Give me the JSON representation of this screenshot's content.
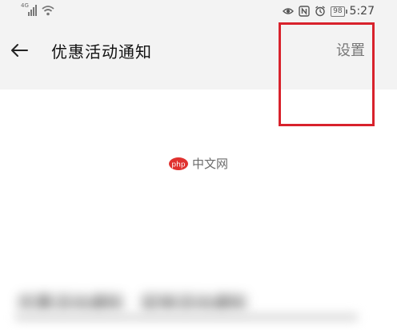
{
  "status_bar": {
    "network_type": "4G",
    "battery_level": "98",
    "time": "5:27",
    "icons": [
      "signal-icon",
      "wifi-icon",
      "eye-icon",
      "nfc-icon",
      "alarm-icon",
      "battery-icon"
    ]
  },
  "header": {
    "back_icon": "arrow-left-icon",
    "title": "优惠活动通知",
    "settings_label": "设置"
  },
  "watermark": {
    "brand_text": "中文网",
    "logo_text": "php"
  },
  "content": {
    "blurred_line_1": "优惠活动通知",
    "blurred_line_2": "促销活动通知"
  },
  "colors": {
    "highlight_border": "#d8222c",
    "accent": "#e0312f"
  }
}
